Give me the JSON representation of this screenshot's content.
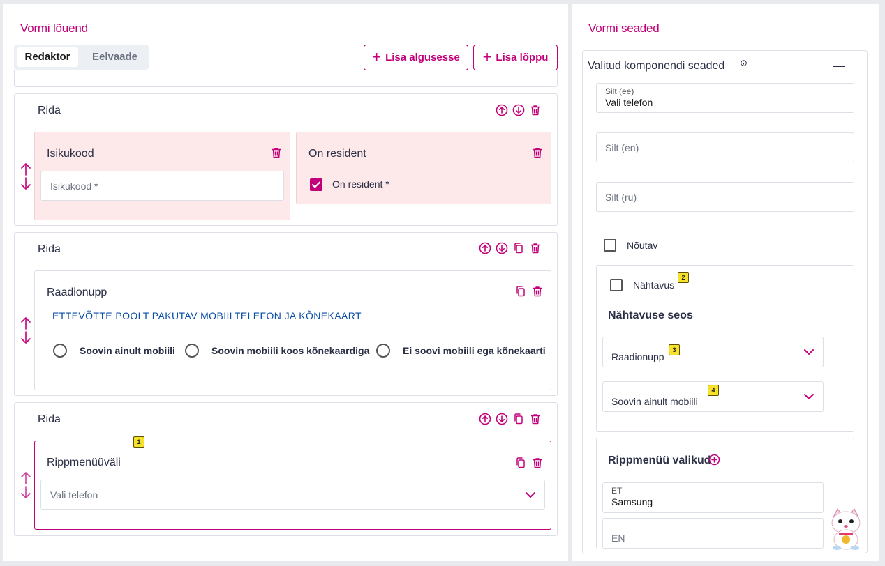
{
  "left": {
    "title": "Vormi lõuend",
    "tabs": [
      {
        "label": "Redaktor",
        "active": true
      },
      {
        "label": "Eelvaade",
        "active": false
      }
    ],
    "buttons": {
      "add_start": "Lisa algusesse",
      "add_end": "Lisa lõppu"
    },
    "rows": [
      {
        "title": "Rida",
        "components": [
          {
            "title": "Isikukood",
            "type": "text",
            "placeholder": "Isikukood *"
          },
          {
            "title": "On resident",
            "type": "checkbox",
            "checkbox_label": "On resident *",
            "checked": true
          }
        ]
      },
      {
        "title": "Rida",
        "components": [
          {
            "title": "Raadionupp",
            "type": "radio",
            "heading": "ETTEVÕTTE POOLT PAKUTAV MOBIILTELEFON JA KÕNEKAART",
            "options": [
              "Soovin ainult mobiili",
              "Soovin mobiili koos kõnekaardiga",
              "Ei soovi mobiili ega kõnekaarti"
            ]
          }
        ]
      },
      {
        "title": "Rida",
        "components": [
          {
            "title": "Rippmenüüväli",
            "type": "dropdown",
            "placeholder": "Vali telefon",
            "badge": "1"
          }
        ]
      }
    ]
  },
  "right": {
    "title": "Vormi seaded",
    "section_title": "Valitud komponendi seaded",
    "label_ee": {
      "label": "Silt (ee)",
      "value": "Vali telefon"
    },
    "label_en": {
      "placeholder": "Silt (en)"
    },
    "label_ru": {
      "placeholder": "Silt (ru)"
    },
    "required_label": "Nõutav",
    "visibility": {
      "label": "Nähtavus",
      "badge": "2",
      "relation_title": "Nähtavuse seos",
      "component_select": {
        "value": "Raadionupp",
        "badge": "3"
      },
      "value_select": {
        "value": "Soovin ainult mobiili",
        "badge": "4"
      }
    },
    "dropdown_options": {
      "title": "Rippmenüü valikud",
      "et": {
        "label": "ET",
        "value": "Samsung"
      },
      "en": {
        "placeholder": "EN"
      }
    }
  },
  "colors": {
    "accent": "#c2007a",
    "pink_bg": "#fde9ea",
    "link_blue": "#0a4ea6"
  }
}
